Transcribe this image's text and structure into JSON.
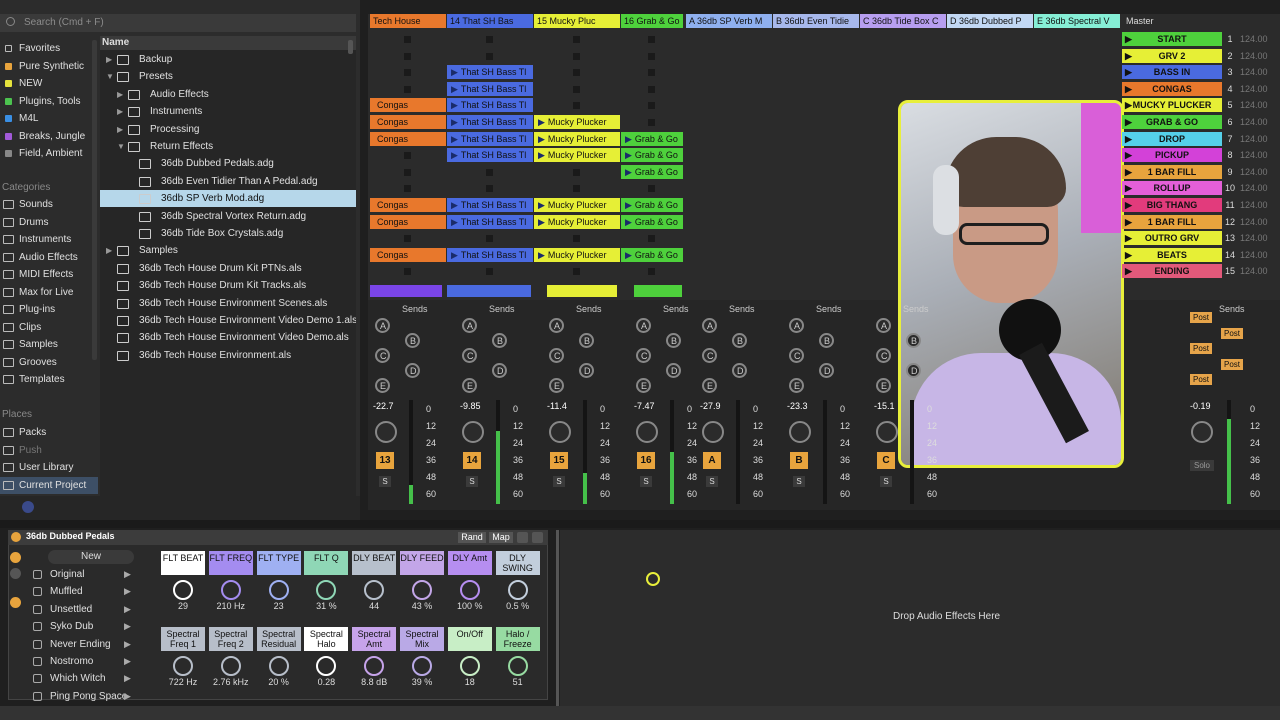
{
  "browser": {
    "search_placeholder": "Search (Cmd + F)",
    "collections": [
      {
        "label": "Favorites",
        "color": ""
      },
      {
        "label": "Pure Synthetic",
        "color": "#e8a43d"
      },
      {
        "label": "NEW",
        "color": "#e6e33d"
      },
      {
        "label": "Plugins, Tools",
        "color": "#4cc34f"
      },
      {
        "label": "M4L",
        "color": "#3a8fe4"
      },
      {
        "label": "Breaks, Jungle",
        "color": "#a25ad8"
      },
      {
        "label": "Field, Ambient",
        "color": "#888888"
      }
    ],
    "categories_heading": "Categories",
    "categories": [
      "Sounds",
      "Drums",
      "Instruments",
      "Audio Effects",
      "MIDI Effects",
      "Max for Live",
      "Plug-ins",
      "Clips",
      "Samples",
      "Grooves",
      "Templates"
    ],
    "places_heading": "Places",
    "places": [
      "Packs",
      "Push",
      "User Library",
      "Current Project"
    ],
    "name_header": "Name",
    "files": [
      {
        "label": "Backup",
        "indent": 0,
        "type": "folder"
      },
      {
        "label": "Presets",
        "indent": 0,
        "type": "folder"
      },
      {
        "label": "Audio Effects",
        "indent": 1,
        "type": "folder"
      },
      {
        "label": "Instruments",
        "indent": 1,
        "type": "folder"
      },
      {
        "label": "Processing",
        "indent": 1,
        "type": "folder"
      },
      {
        "label": "Return Effects",
        "indent": 1,
        "type": "folder"
      },
      {
        "label": "36db Dubbed Pedals.adg",
        "indent": 2,
        "type": "file"
      },
      {
        "label": "36db Even Tidier Than A Pedal.adg",
        "indent": 2,
        "type": "file"
      },
      {
        "label": "36db SP Verb Mod.adg",
        "indent": 2,
        "type": "file",
        "selected": true
      },
      {
        "label": "36db Spectral Vortex Return.adg",
        "indent": 2,
        "type": "file"
      },
      {
        "label": "36db Tide Box Crystals.adg",
        "indent": 2,
        "type": "file"
      },
      {
        "label": "Samples",
        "indent": 0,
        "type": "folder"
      },
      {
        "label": "36db Tech House Drum Kit PTNs.als",
        "indent": 0,
        "type": "file"
      },
      {
        "label": "36db Tech House Drum Kit Tracks.als",
        "indent": 0,
        "type": "file"
      },
      {
        "label": "36db Tech House Environment Scenes.als",
        "indent": 0,
        "type": "file"
      },
      {
        "label": "36db Tech House Environment Video Demo 1.als",
        "indent": 0,
        "type": "file"
      },
      {
        "label": "36db Tech House Environment Video Demo.als",
        "indent": 0,
        "type": "file"
      },
      {
        "label": "36db Tech House Environment.als",
        "indent": 0,
        "type": "file"
      }
    ]
  },
  "tracks": [
    {
      "name": "Tech House",
      "color": "#e8782c",
      "number": "13",
      "volume": "-22.7"
    },
    {
      "name": "14 That SH Bas",
      "color": "#4a6ae0",
      "number": "14",
      "volume": "-9.85"
    },
    {
      "name": "15 Mucky Pluc",
      "color": "#e6ef36",
      "number": "15",
      "volume": "-11.4"
    },
    {
      "name": "16 Grab & Go",
      "color": "#4ed13c",
      "number": "16",
      "volume": "-7.47"
    },
    {
      "name": "A 36db SP Verb M",
      "color": "#8fb0ef",
      "number": "A",
      "volume": "-27.9"
    },
    {
      "name": "B 36db Even Tidie",
      "color": "#a7b8ec",
      "number": "B",
      "volume": "-23.3"
    },
    {
      "name": "C 36db Tide Box C",
      "color": "#b79ef0",
      "number": "C",
      "volume": "-15.1"
    },
    {
      "name": "D 36db Dubbed P",
      "color": "#c2d8f4",
      "number": "D",
      "volume": ""
    },
    {
      "name": "E 36db Spectral V",
      "color": "#86efd6",
      "number": "E",
      "volume": ""
    }
  ],
  "clips": {
    "congas": "Congas",
    "bass": "That SH Bass Tl",
    "mucky": "Mucky Plucker",
    "grab": "Grab & Go"
  },
  "master": {
    "name": "Master",
    "volume": "-0.19",
    "solo": "Solo"
  },
  "scenes": [
    {
      "label": "START",
      "color": "#4ed13c",
      "num": "1"
    },
    {
      "label": "GRV 2",
      "color": "#e6ef36",
      "num": "2"
    },
    {
      "label": "BASS IN",
      "color": "#4a6ae0",
      "num": "3"
    },
    {
      "label": "CONGAS",
      "color": "#e8782c",
      "num": "4"
    },
    {
      "label": "MUCKY PLUCKER",
      "color": "#e6ef36",
      "num": "5"
    },
    {
      "label": "GRAB & GO",
      "color": "#4ed13c",
      "num": "6"
    },
    {
      "label": "DROP",
      "color": "#55d0ea",
      "num": "7"
    },
    {
      "label": "PICKUP",
      "color": "#d341d8",
      "num": "8"
    },
    {
      "label": "1 BAR FILL",
      "color": "#e8a43d",
      "num": "9"
    },
    {
      "label": "ROLLUP",
      "color": "#e45fd8",
      "num": "10"
    },
    {
      "label": "BIG THANG",
      "color": "#e23b7c",
      "num": "11"
    },
    {
      "label": "1 BAR FILL",
      "color": "#e8a43d",
      "num": "12"
    },
    {
      "label": "OUTRO GRV",
      "color": "#e6ef36",
      "num": "13"
    },
    {
      "label": "BEATS",
      "color": "#e6ef36",
      "num": "14"
    },
    {
      "label": "ENDING",
      "color": "#e2597a",
      "num": "15"
    }
  ],
  "tempo": "124.00",
  "mixer": {
    "sends_label": "Sends",
    "send_letters": [
      "A",
      "B",
      "C",
      "D",
      "E"
    ],
    "solo_label": "S",
    "post_label": "Post",
    "scale": [
      "0",
      "12",
      "24",
      "36",
      "48",
      "60"
    ]
  },
  "device": {
    "title": "36db Dubbed Pedals",
    "rand_label": "Rand",
    "map_label": "Map",
    "new_label": "New",
    "presets": [
      "Original",
      "Muffled",
      "Unsettled",
      "Syko Dub",
      "Never Ending",
      "Nostromo",
      "Which Witch",
      "Ping Pong Space"
    ],
    "macros_top": [
      {
        "label": "FLT BEAT",
        "color": "#ffffff",
        "value": "29"
      },
      {
        "label": "FLT FREQ",
        "color": "#a48cf0",
        "value": "210 Hz"
      },
      {
        "label": "FLT TYPE",
        "color": "#9fb0f2",
        "value": "23"
      },
      {
        "label": "FLT Q",
        "color": "#8fd7b6",
        "value": "31 %"
      },
      {
        "label": "DLY BEAT",
        "color": "#b7c0cc",
        "value": "44"
      },
      {
        "label": "DLY FEED",
        "color": "#c3a6e8",
        "value": "43 %"
      },
      {
        "label": "DLY Amt",
        "color": "#b68ef0",
        "value": "100 %"
      },
      {
        "label": "DLY SWING",
        "color": "#c2cedc",
        "value": "0.5 %"
      }
    ],
    "macros_bottom": [
      {
        "label": "Spectral Freq 1",
        "color": "#b7bec9",
        "value": "722 Hz"
      },
      {
        "label": "Spectral Freq 2",
        "color": "#b7bec9",
        "value": "2.76 kHz"
      },
      {
        "label": "Spectral Residual",
        "color": "#b7bec9",
        "value": "20 %"
      },
      {
        "label": "Spectral Halo",
        "color": "#ffffff",
        "value": "0.28"
      },
      {
        "label": "Spectral Amt",
        "color": "#c6a3ea",
        "value": "8.8 dB"
      },
      {
        "label": "Spectral Mix",
        "color": "#b9a9e6",
        "value": "39 %"
      },
      {
        "label": "On/Off",
        "color": "#c8eec6",
        "value": "18"
      },
      {
        "label": "Halo / Freeze",
        "color": "#97dba2",
        "value": "51"
      }
    ]
  },
  "dropzone": {
    "label": "Drop Audio Effects Here"
  }
}
